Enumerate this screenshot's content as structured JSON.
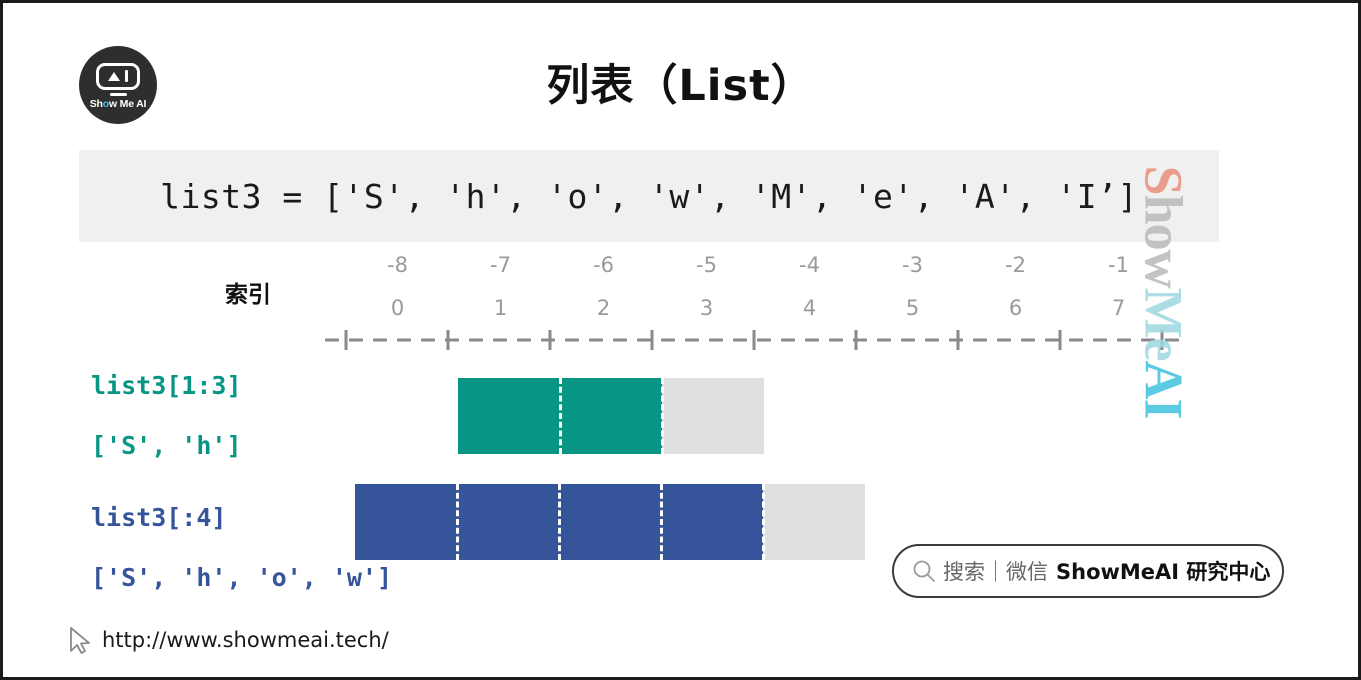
{
  "slide": {
    "title": "列表（List）",
    "border_color": "#1b1b1b"
  },
  "logo": {
    "name": "ShowMeAI",
    "brand_pre": "Sh",
    "brand_o": "o",
    "brand_post": "w Me AI"
  },
  "code": {
    "text": "list3 = ['S', 'h', 'o', 'w', 'M', 'e', 'A', 'I’]",
    "band_color": "#f0f0f0"
  },
  "index": {
    "label": "索引",
    "negative": [
      "-8",
      "-7",
      "-6",
      "-5",
      "-4",
      "-3",
      "-2",
      "-1"
    ],
    "positive": [
      "0",
      "1",
      "2",
      "3",
      "4",
      "5",
      "6",
      "7"
    ],
    "tick_color": "#8a8a8a"
  },
  "slices": [
    {
      "expression": "list3[1:3]",
      "result": "['S', 'h']",
      "color": "#079584",
      "start_index": 1,
      "filled_cells": 2,
      "empty_cells": 1
    },
    {
      "expression": "list3[:4]",
      "result": "['S', 'h', 'o', 'w']",
      "color": "#35549A",
      "start_index": 0,
      "filled_cells": 4,
      "empty_cells": 1
    }
  ],
  "watermark": {
    "part1": "S",
    "part2": "how",
    "part3": "Me",
    "part4": "AI"
  },
  "search_pill": {
    "text": "搜索｜微信",
    "bold_text": "ShowMeAI 研究中心"
  },
  "footer": {
    "url": "http://www.showmeai.tech/"
  }
}
